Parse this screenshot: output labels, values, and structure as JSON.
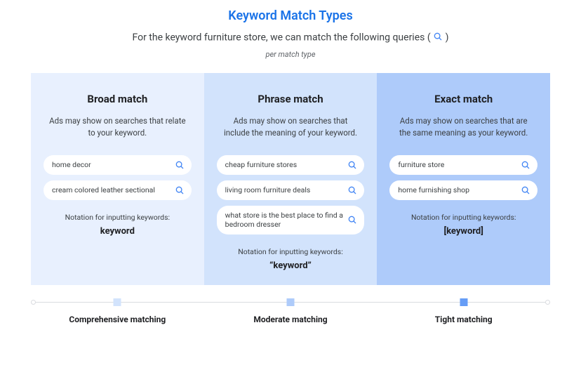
{
  "title": "Keyword Match Types",
  "subtitle_pre": "For the keyword furniture store, we can match the following queries (",
  "subtitle_post": ")",
  "per_match": "per match type",
  "notation_label": "Notation for inputting keywords:",
  "columns": [
    {
      "title": "Broad match",
      "desc": "Ads may show on searches that relate to your keyword.",
      "pills": [
        "home decor",
        "cream colored leather sectional"
      ],
      "notation": "keyword",
      "timeline": "Comprehensive matching"
    },
    {
      "title": "Phrase match",
      "desc": "Ads may show on searches that include the meaning of your keyword.",
      "pills": [
        "cheap furniture stores",
        "living room furniture deals",
        "what store is the best place to find a bedroom dresser"
      ],
      "notation": "“keyword”",
      "timeline": "Moderate matching"
    },
    {
      "title": "Exact match",
      "desc": "Ads may show on searches that are the same meaning as your keyword.",
      "pills": [
        "furniture store",
        "home furnishing shop"
      ],
      "notation": "[keyword]",
      "timeline": "Tight matching"
    }
  ]
}
